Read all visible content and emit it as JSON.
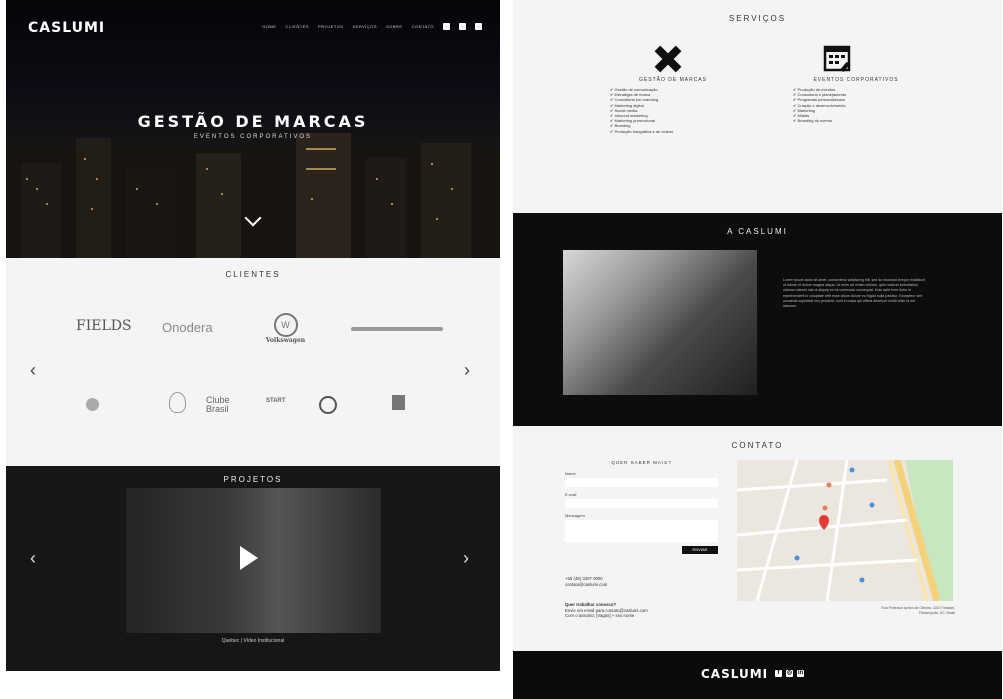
{
  "header": {
    "logo": "CASLUMI",
    "nav": [
      "HOME",
      "CLIENTES",
      "PROJETOS",
      "SERVIÇOS",
      "SOBRE",
      "CONTATO"
    ],
    "social_icons": [
      "facebook-icon",
      "instagram-icon",
      "linkedin-icon"
    ]
  },
  "hero": {
    "title": "GESTÃO DE MARCAS",
    "subtitle": "EVENTOS CORPORATIVOS"
  },
  "clients": {
    "title": "CLIENTES",
    "logos": [
      "FIELDS",
      "Onodera",
      "Volkswagen",
      "",
      "",
      "",
      "Clube Brasil",
      "START",
      ""
    ],
    "prev": "‹",
    "next": "›"
  },
  "projects": {
    "title": "PROJETOS",
    "caption": "Quebec | Vídeo Institucional",
    "prev": "‹",
    "next": "›"
  },
  "services": {
    "title": "SERVIÇOS",
    "columns": [
      {
        "heading": "GESTÃO DE MARCAS",
        "items": [
          "Gestão de comunicação",
          "Estratégia de marca",
          "Consultoria em branding",
          "Marketing digital",
          "Social media",
          "Inbound marketing",
          "Marketing promocional",
          "Branding",
          "Produção fotográfica e de vídeos"
        ]
      },
      {
        "heading": "EVENTOS CORPORATIVOS",
        "items": [
          "Produção de eventos",
          "Consultoria e planejamento",
          "Programas personalizados",
          "Criação e desenvolvimento",
          "Marketing",
          "Mídias",
          "Branding do evento"
        ]
      }
    ]
  },
  "about": {
    "title": "A CASLUMI",
    "text": "Lorem ipsum dolor sit amet, consectetur adipiscing elit, sed do eiusmod tempor incididunt ut labore et dolore magna aliqua. Ut enim ad minim veniam, quis nostrud exercitation ullamco laboris nisi ut aliquip ex ea commodo consequat. Duis aute irure dolor in reprehenderit in voluptate velit esse cillum dolore eu fugiat nulla pariatur. Excepteur sint occaecat cupidatat non proident, sunt in culpa qui officia deserunt mollit anim id est laborum."
  },
  "contact": {
    "title": "CONTATO",
    "form_title": "QUER SABER MAIS?",
    "fields": [
      "Nome",
      "E-mail",
      "Mensagem"
    ],
    "send": "ENVIAR",
    "phone": "+55 (48) 3307 0000",
    "email": "contato@caslumi.com",
    "work_title": "Quer trabalhar conosco?",
    "work_text": "Envie um email para contato@caslumi.com",
    "work_text2": "Com o assunto: [Vagas] + seu nome",
    "address": "Rua Professor Ayrton de Oliveira, 1100 Trindade, Florianópolis, SC, Brasil"
  },
  "footer": {
    "logo": "CASLUMI"
  }
}
